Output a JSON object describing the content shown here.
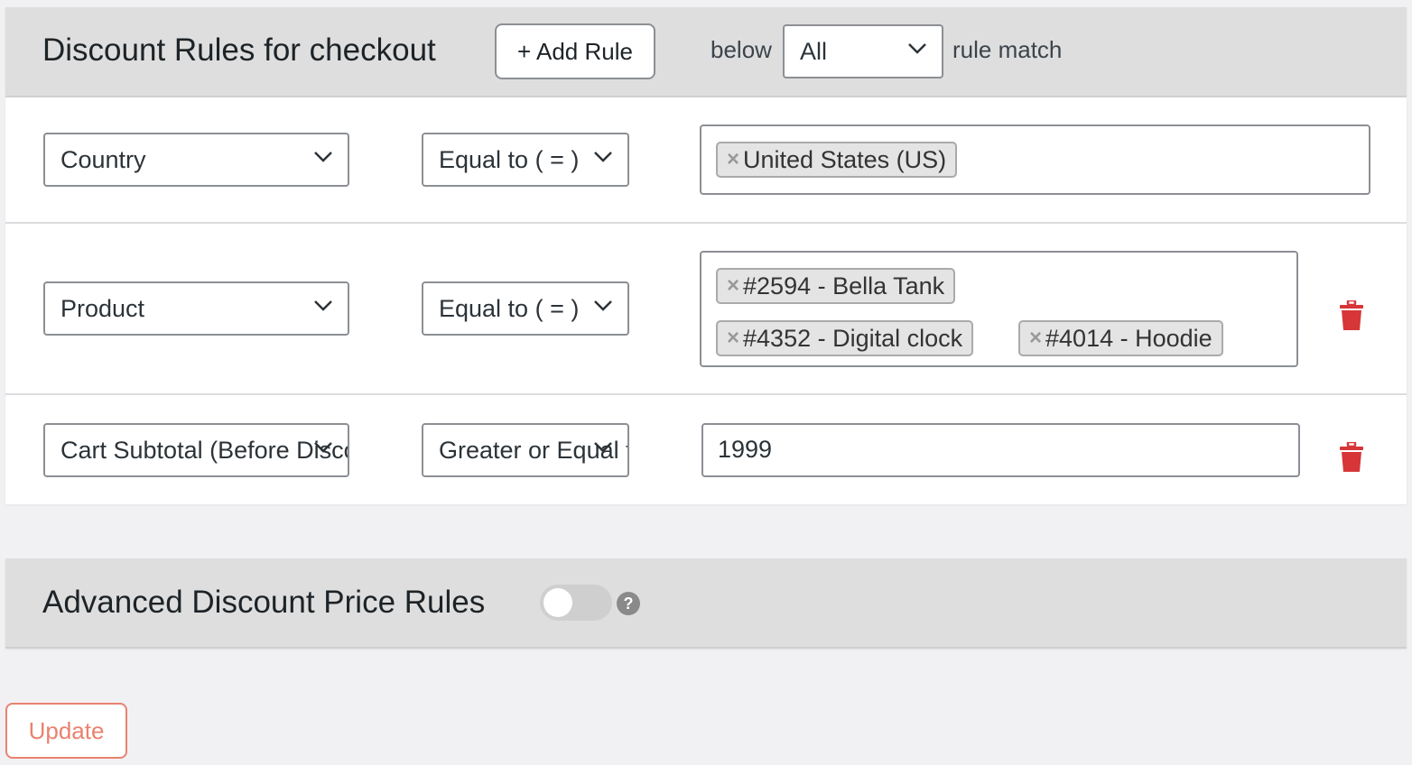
{
  "rules_panel": {
    "title": "Discount Rules for checkout",
    "add_rule_label": "+ Add Rule",
    "below_label": "below",
    "match_select": "All",
    "rule_match_label": "rule match",
    "rules": [
      {
        "condition": "Country",
        "operator": "Equal to ( = )",
        "tags": [
          "United States (US)"
        ],
        "deletable": false
      },
      {
        "condition": "Product",
        "operator": "Equal to ( = )",
        "tags": [
          "#2594 - Bella Tank",
          "#4352 - Digital clock",
          "#4014 - Hoodie"
        ],
        "deletable": true
      },
      {
        "condition": "Cart Subtotal (Before Discount)",
        "operator": "Greater or Equal to ( >= )",
        "value": "1999",
        "deletable": true
      }
    ]
  },
  "advanced_panel": {
    "title": "Advanced Discount Price Rules",
    "toggle_on": false,
    "help_icon": "question-circle-icon"
  },
  "update_label": "Update",
  "colors": {
    "delete": "#d63638",
    "update": "#e9826f",
    "header_bg": "#dedede",
    "page_bg": "#f1f1f3"
  }
}
